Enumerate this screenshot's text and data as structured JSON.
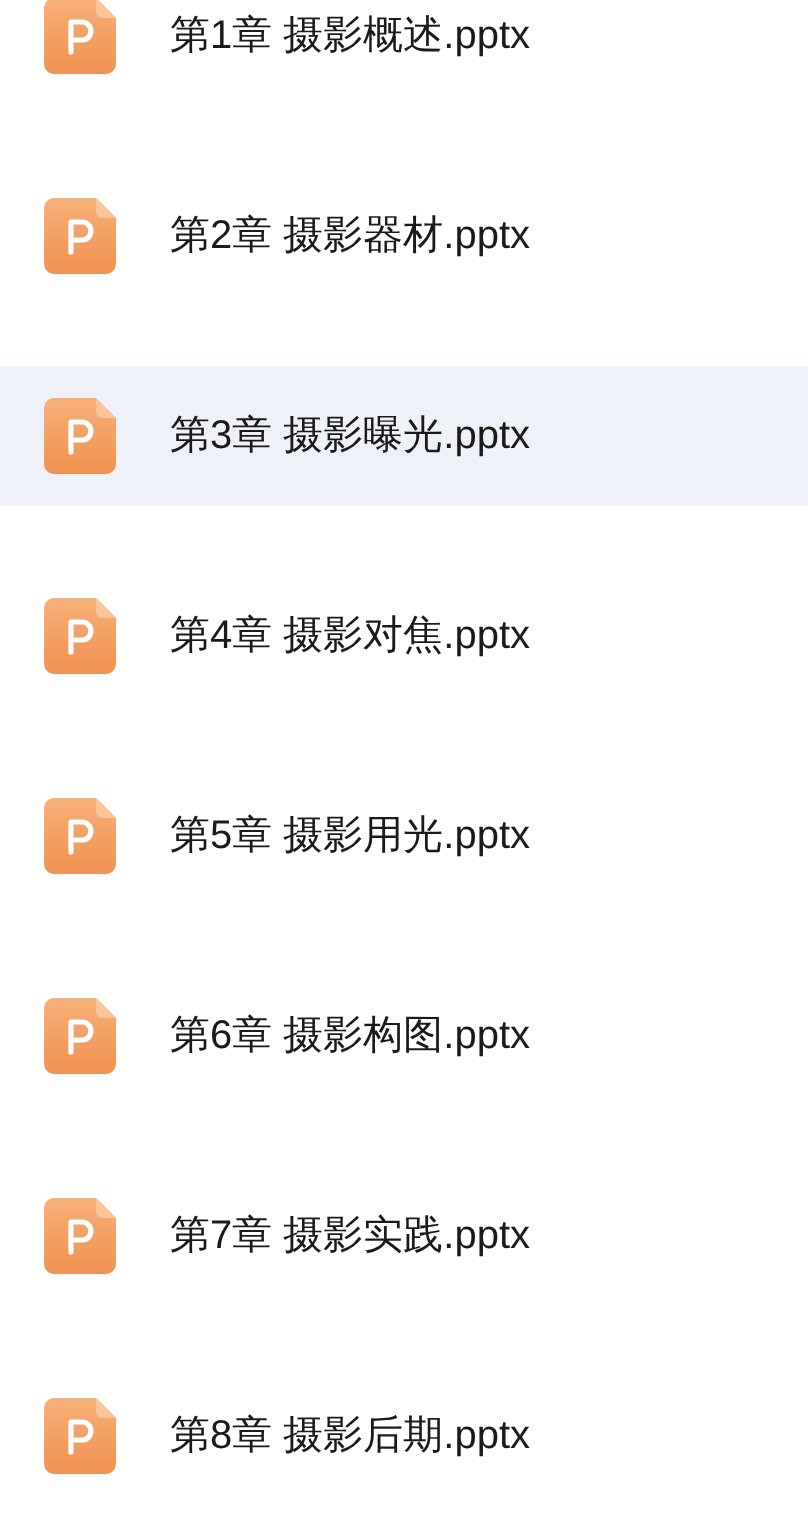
{
  "files": [
    {
      "name": "第1章 摄影概述.pptx",
      "selected": false
    },
    {
      "name": "第2章 摄影器材.pptx",
      "selected": false
    },
    {
      "name": "第3章 摄影曝光.pptx",
      "selected": true
    },
    {
      "name": "第4章 摄影对焦.pptx",
      "selected": false
    },
    {
      "name": "第5章 摄影用光.pptx",
      "selected": false
    },
    {
      "name": "第6章 摄影构图.pptx",
      "selected": false
    },
    {
      "name": "第7章 摄影实践.pptx",
      "selected": false
    },
    {
      "name": "第8章 摄影后期.pptx",
      "selected": false
    }
  ]
}
